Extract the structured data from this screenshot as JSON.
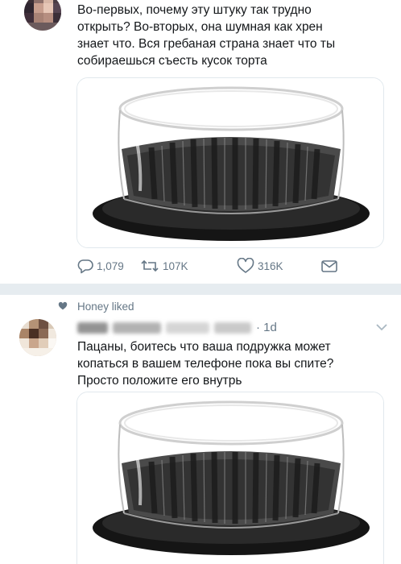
{
  "tweet1": {
    "text": "Во-первых, почему эту штуку так трудно\nоткрыть? Во-вторых, она шумная как хрен\nзнает что. Вся гребаная страна знает что ты\nсобираешься съесть кусок торта",
    "image": "plastic-cake-container",
    "actions": {
      "replies": "1,079",
      "retweets": "107K",
      "likes": "316K"
    }
  },
  "social_context": {
    "icon": "heart-icon",
    "text": "Honey liked"
  },
  "tweet2": {
    "time": "· 1d",
    "text": "Пацаны, боитесь что ваша подружка может\nкопаться в вашем телефоне пока вы спите?\nПросто положите его внутрь",
    "image": "plastic-cake-container"
  },
  "colors": {
    "text": "#14171a",
    "secondary": "#657786",
    "separator": "#e6ecf0",
    "border": "#e1e8ed"
  }
}
